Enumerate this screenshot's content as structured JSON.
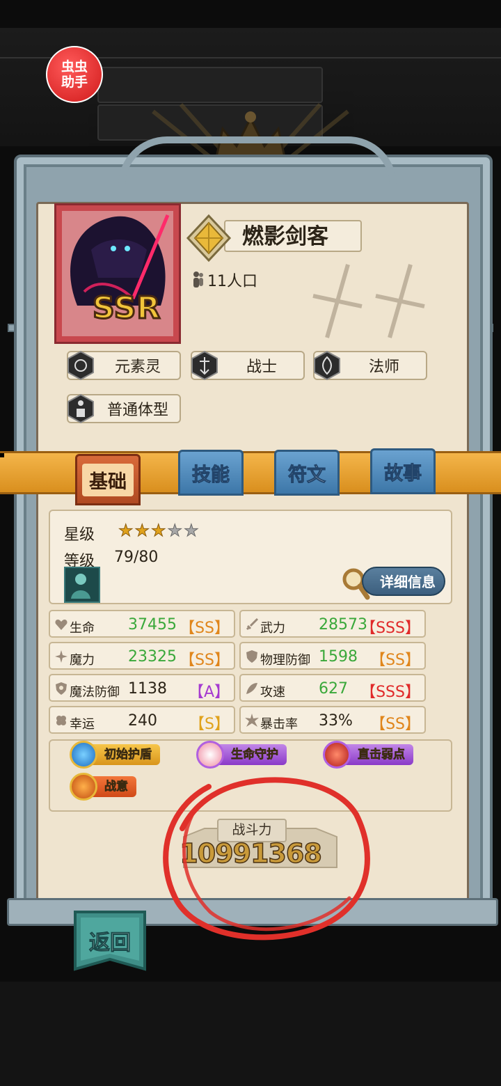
{
  "overlay_badge": {
    "line1": "虫虫",
    "line2": "助手"
  },
  "hero": {
    "name": "燃影剑客",
    "rarity": "SSR",
    "population": "11人口",
    "tags": [
      "元素灵",
      "战士",
      "法师",
      "普通体型"
    ]
  },
  "tabs": [
    {
      "label": "基础",
      "active": true
    },
    {
      "label": "技能",
      "active": false
    },
    {
      "label": "符文",
      "active": false
    },
    {
      "label": "故事",
      "active": false
    }
  ],
  "info": {
    "star_label": "星级",
    "stars_filled": 3,
    "stars_total": 5,
    "level_label": "等级",
    "level_value": "79/80",
    "detail_button": "详细信息"
  },
  "stats": [
    {
      "name": "生命",
      "value": "37455",
      "grade": "【SS】"
    },
    {
      "name": "武力",
      "value": "28573",
      "grade": "【SSS】"
    },
    {
      "name": "魔力",
      "value": "23325",
      "grade": "【SS】"
    },
    {
      "name": "物理防御",
      "value": "1598",
      "grade": "【SS】"
    },
    {
      "name": "魔法防御",
      "value": "1138",
      "grade": "【A】"
    },
    {
      "name": "攻速",
      "value": "627",
      "grade": "【SSS】"
    },
    {
      "name": "幸运",
      "value": "240",
      "grade": "【S】"
    },
    {
      "name": "暴击率",
      "value": "33%",
      "grade": "【SS】"
    }
  ],
  "skills": [
    "初始护盾",
    "生命守护",
    "直击弱点",
    "战意"
  ],
  "power": {
    "label": "战斗力",
    "value": "10991368"
  },
  "back_button": "返回",
  "colors": {
    "annotation_circle": "#e0302a",
    "tab_active": "#b04a22",
    "tab_inactive": "#3d77a8",
    "ribbon": "#e3a033"
  }
}
